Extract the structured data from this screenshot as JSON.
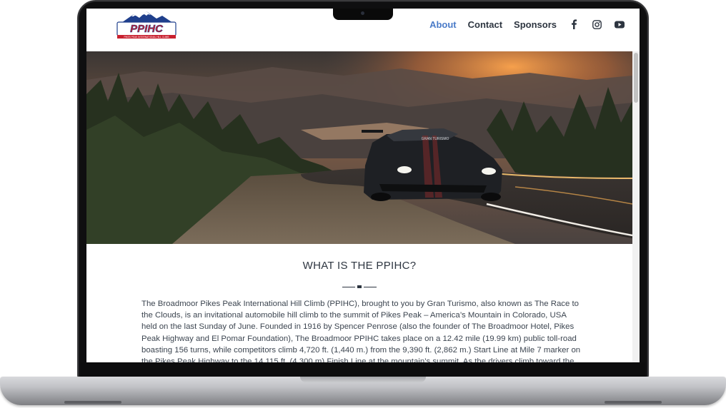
{
  "site": {
    "logo_text": "PPIHC",
    "logo_subtext": "PIKES PEAK INTERNATIONAL HILL CLIMB"
  },
  "nav": {
    "items": [
      {
        "label": "About",
        "active": true
      },
      {
        "label": "Contact",
        "active": false
      },
      {
        "label": "Sponsors",
        "active": false
      }
    ],
    "social_icons": [
      "facebook-icon",
      "instagram-icon",
      "youtube-icon"
    ]
  },
  "hero": {
    "image_description": "Sports car driving on mountain road at sunset",
    "car_badge_text": "GRAN TURISMO"
  },
  "section": {
    "title": "WHAT IS THE PPIHC?",
    "body": "The Broadmoor Pikes Peak International Hill Climb (PPIHC), brought to you by Gran Turismo, also known as The Race to the Clouds, is an invitational automobile hill climb to the summit of Pikes Peak – America’s Mountain in Colorado, USA held on the last Sunday of June. Founded in 1916 by Spencer Penrose (also the founder of The Broadmoor Hotel, Pikes Peak Highway and El Pomar Foundation), The Broadmoor PPIHC takes place on a 12.42 mile (19.99 km) public toll-road boasting 156 turns, while competitors climb 4,720 ft. (1,440 m.) from the 9,390 ft. (2,862 m.) Start Line at Mile 7 marker on the Pikes Peak Highway to the 14,115 ft. (4,300 m) Finish Line at the mountain’s summit. As the drivers climb toward the summit, the"
  },
  "colors": {
    "nav_active": "#4a7bc8",
    "nav_text": "#2d3540",
    "body_text": "#3c4550",
    "logo_red": "#c8202f",
    "logo_blue": "#1f3f8c"
  }
}
